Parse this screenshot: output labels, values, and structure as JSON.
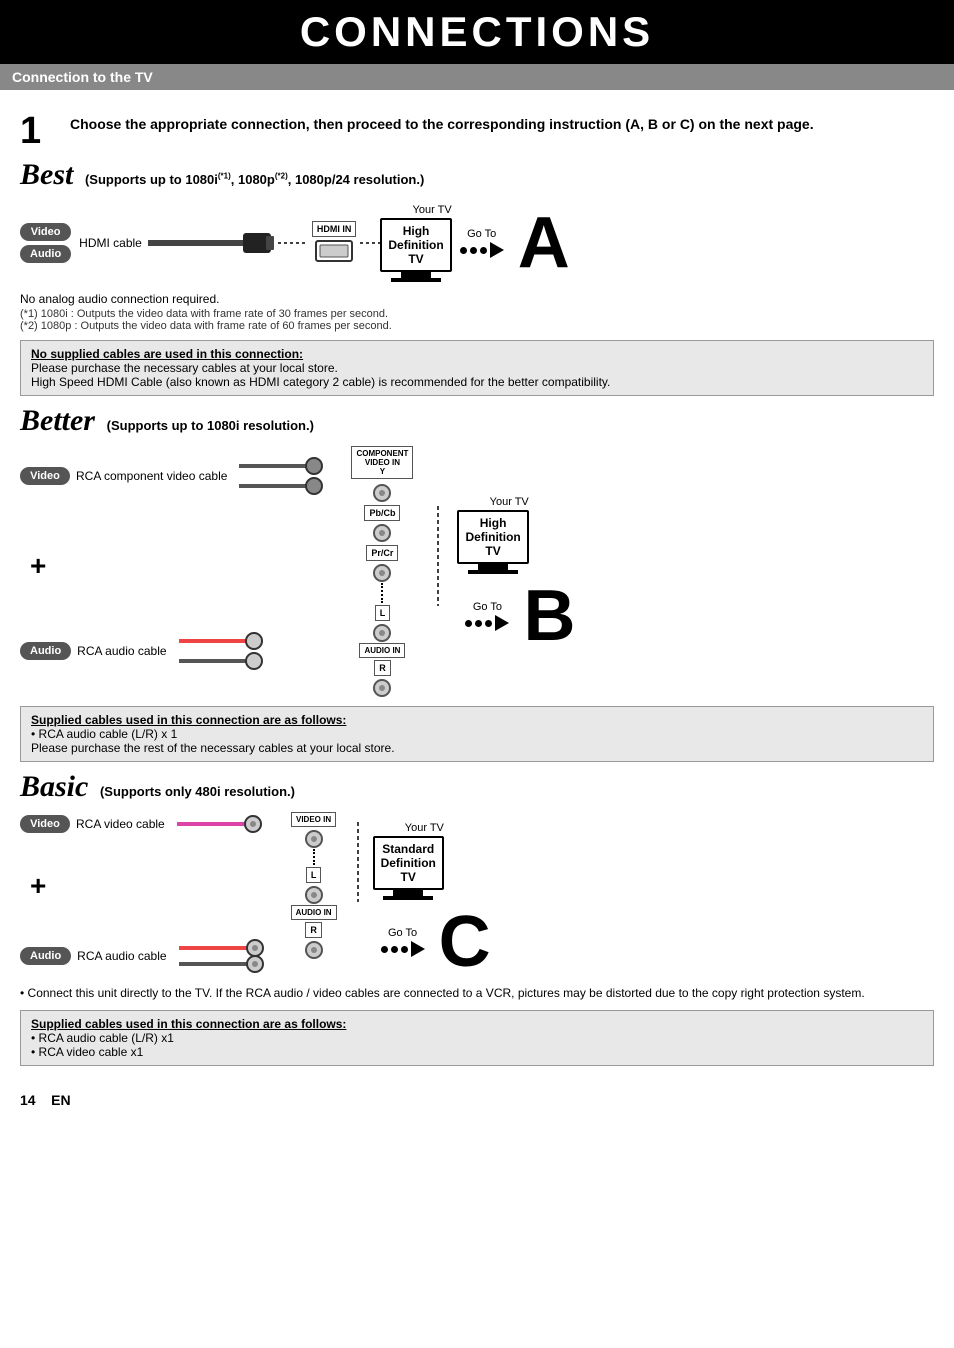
{
  "header": {
    "title": "CONNECTIONS"
  },
  "section1": {
    "title": "Connection to the TV"
  },
  "step1": {
    "number": "1",
    "text": "Choose the appropriate connection, then proceed to the corresponding instruction (A, B or C) on the next page."
  },
  "best": {
    "label": "Best",
    "subtitle": "(Supports up to 1080i",
    "sup1": "(*1)",
    "subtitle2": ", 1080p",
    "sup2": "(*2)",
    "subtitle3": ", 1080p/24 resolution.)",
    "video_badge": "Video",
    "audio_badge": "Audio",
    "cable_label": "HDMI cable",
    "port_label": "HDMI IN",
    "your_tv": "Your TV",
    "tv_line1": "High",
    "tv_line2": "Definition",
    "tv_line3": "TV",
    "goto": "Go To",
    "letter": "A",
    "note": "No analog audio connection required.",
    "footnote1": "(*1) 1080i : Outputs the video data with frame rate of 30 frames per second.",
    "footnote2": "(*2) 1080p : Outputs the video data with frame rate of 60 frames per second.",
    "infobox_title": "No supplied cables are used in this connection:",
    "infobox_line1": "Please purchase the necessary cables at your local store.",
    "infobox_line2": "High Speed HDMI Cable (also known as HDMI category 2 cable) is recommended for the better compatibility."
  },
  "better": {
    "label": "Better",
    "subtitle": "(Supports up to 1080i resolution.)",
    "video_badge": "Video",
    "video_cable": "RCA component video cable",
    "audio_badge": "Audio",
    "audio_cable": "RCA audio cable",
    "port_y": "COMPONENT VIDEO IN Y",
    "port_pb": "Pb/Cb",
    "port_pr": "Pr/Cr",
    "port_audio_l": "L",
    "port_audio": "AUDIO IN",
    "port_audio_r": "R",
    "your_tv": "Your TV",
    "tv_line1": "High",
    "tv_line2": "Definition",
    "tv_line3": "TV",
    "goto": "Go To",
    "letter": "B",
    "infobox_title": "Supplied cables used in this connection are as follows:",
    "infobox_line1": "• RCA audio cable (L/R) x 1",
    "infobox_line2": "Please purchase the rest of the necessary cables at your local store."
  },
  "basic": {
    "label": "Basic",
    "subtitle": "(Supports only 480i resolution.)",
    "video_badge": "Video",
    "video_cable": "RCA video cable",
    "audio_badge": "Audio",
    "audio_cable": "RCA audio cable",
    "port_video": "VIDEO IN",
    "port_audio_l": "L",
    "port_audio": "AUDIO IN",
    "port_audio_r": "R",
    "your_tv": "Your TV",
    "tv_line1": "Standard",
    "tv_line2": "Definition",
    "tv_line3": "TV",
    "goto": "Go To",
    "letter": "C",
    "note": "• Connect this unit directly to the TV. If the RCA audio / video cables are connected to a VCR, pictures may be distorted due to the copy right protection system.",
    "infobox_title": "Supplied cables used in this connection are as follows:",
    "infobox_line1": "• RCA audio cable (L/R) x1",
    "infobox_line2": "• RCA video cable x1"
  },
  "footer": {
    "page_number": "14",
    "lang": "EN"
  }
}
